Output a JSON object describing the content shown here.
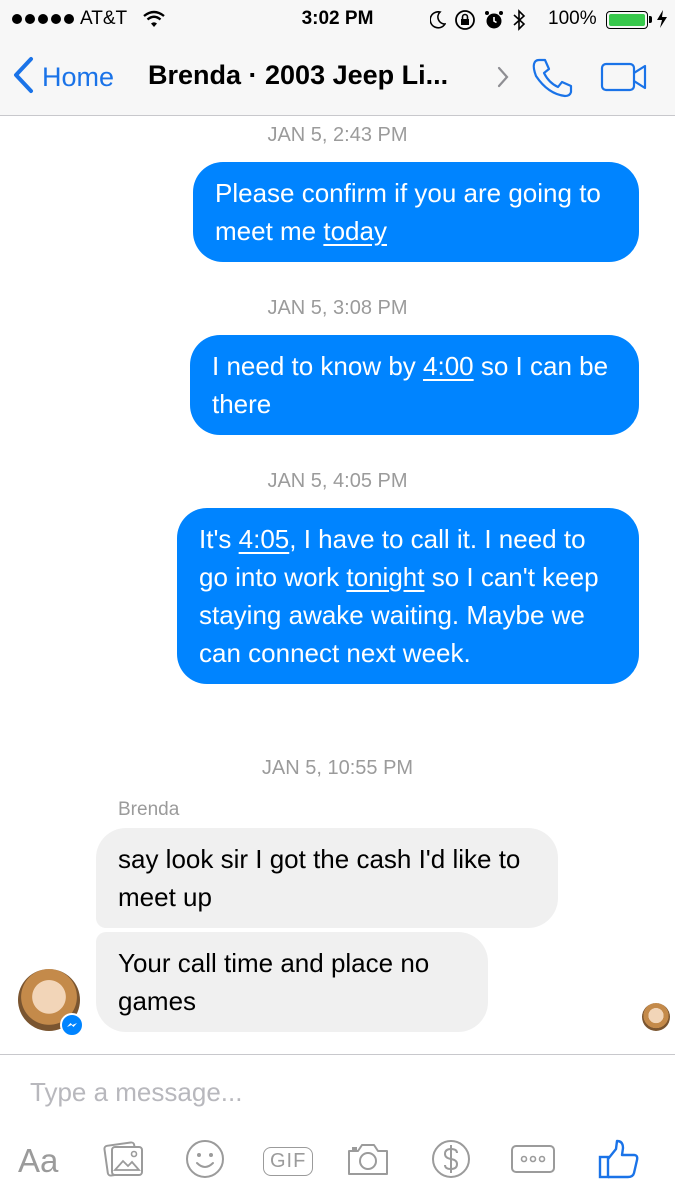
{
  "status_bar": {
    "carrier": "AT&T",
    "time": "3:02 PM",
    "battery_percent": "100%",
    "signal_bars": 5,
    "battery_color": "#38c94c"
  },
  "nav": {
    "back_label": "Home",
    "title": "Brenda · 2003 Jeep Li...",
    "accent_color": "#1a73e8"
  },
  "messages": [
    {
      "type": "timestamp",
      "text": "JAN 5, 2:43 PM"
    },
    {
      "type": "outgoing",
      "parts": [
        "Please confirm if you are going to meet me ",
        "today"
      ]
    },
    {
      "type": "timestamp",
      "text": "JAN 5, 3:08 PM"
    },
    {
      "type": "outgoing",
      "parts": [
        "I need to know by ",
        "4:00",
        " so I can be there"
      ]
    },
    {
      "type": "timestamp",
      "text": "JAN 5, 4:05 PM"
    },
    {
      "type": "outgoing",
      "parts": [
        "It's ",
        "4:05",
        ", I have to call it. I need to go into work ",
        "tonight",
        " so I can't keep staying awake waiting. Maybe we can connect next week."
      ]
    },
    {
      "type": "timestamp",
      "text": "JAN 5, 10:55 PM"
    },
    {
      "type": "sender",
      "text": "Brenda"
    },
    {
      "type": "incoming",
      "text": "say look sir I got the cash I'd like to meet up"
    },
    {
      "type": "incoming",
      "text": "Your call time and place no games"
    }
  ],
  "composer": {
    "placeholder": "Type a message...",
    "value": "",
    "aa_label": "Aa",
    "gif_label": "GIF"
  },
  "colors": {
    "outgoing_bubble": "#0084ff",
    "incoming_bubble": "#f0f0f0",
    "timestamp_text": "#9b9b9b"
  },
  "icons": [
    "wifi-icon",
    "moon-icon",
    "lock-rotation-icon",
    "alarm-icon",
    "bluetooth-icon",
    "chevron-left-icon",
    "chevron-right-icon",
    "phone-icon",
    "video-camera-icon",
    "messenger-icon",
    "image-icon",
    "emoji-icon",
    "camera-icon",
    "dollar-icon",
    "more-icon",
    "thumbs-up-icon"
  ]
}
